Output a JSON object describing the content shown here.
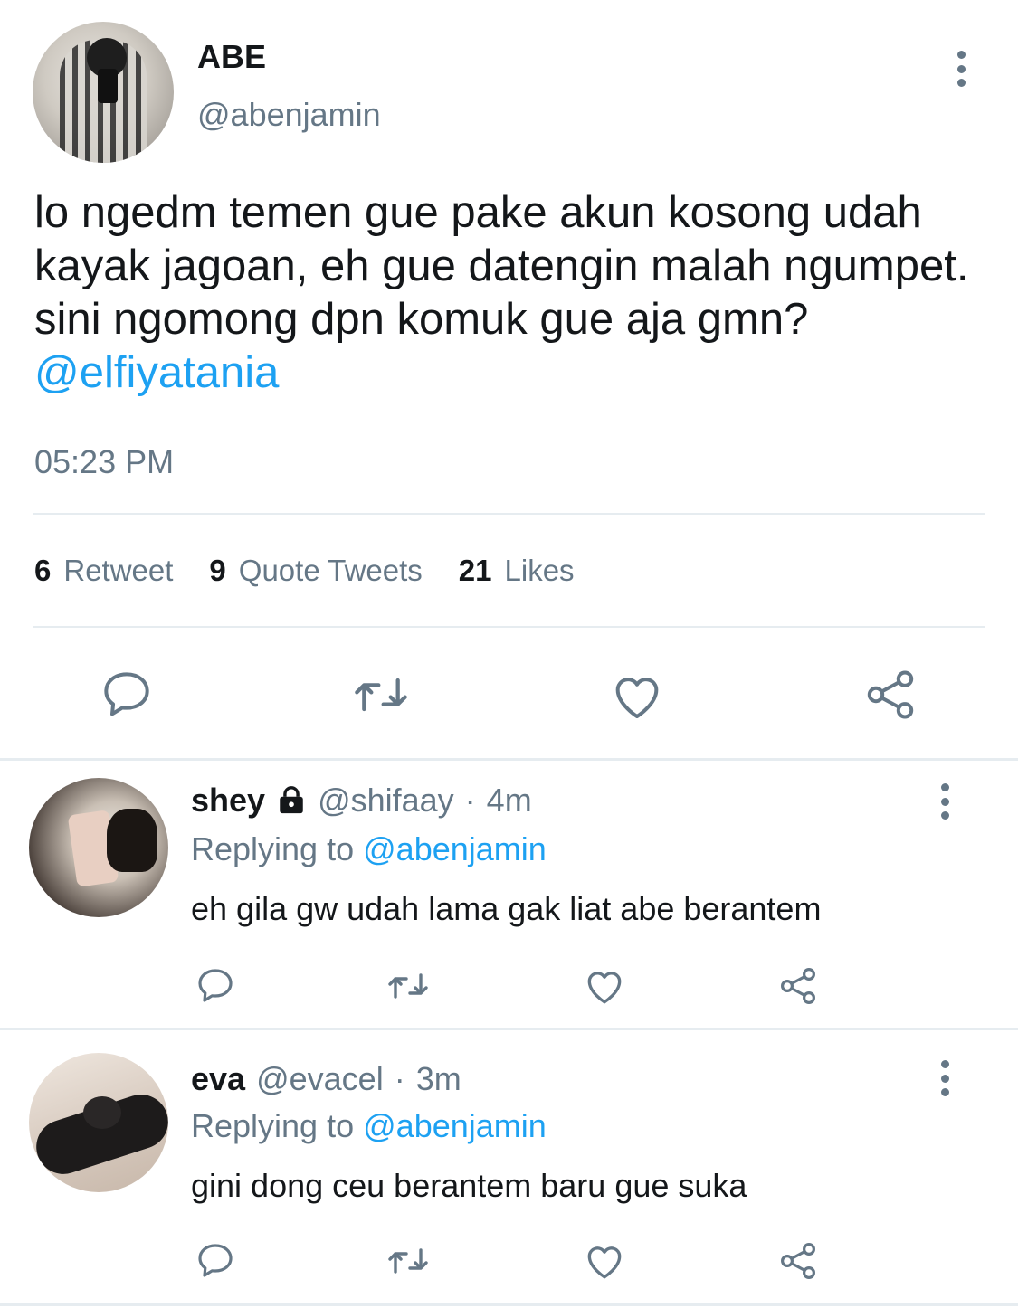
{
  "tweet": {
    "author_name": "ABE",
    "author_handle": "@abenjamin",
    "text_parts": [
      "lo ngedm temen gue pake akun kosong udah kayak jagoan, eh gue datengin malah ngumpet. sini ngomong dpn komuk gue aja gmn? ",
      "@elfiyatania"
    ],
    "time": "05:23 PM",
    "stats": {
      "retweets_count": "6",
      "retweets_label": "Retweet",
      "quotes_count": "9",
      "quotes_label": "Quote Tweets",
      "likes_count": "21",
      "likes_label": "Likes"
    },
    "actions": [
      "reply-icon",
      "retweet-icon",
      "like-icon",
      "share-icon"
    ],
    "avatar": "profile-photo"
  },
  "replies": [
    {
      "name": "shey",
      "locked": true,
      "handle": "@shifaay",
      "separator": "·",
      "time": "4m",
      "replying_prefix": "Replying to",
      "replying_handle": "@abenjamin",
      "text": "eh gila gw udah lama gak liat abe berantem"
    },
    {
      "name": "eva",
      "locked": false,
      "handle": "@evacel",
      "separator": "·",
      "time": "3m",
      "replying_prefix": "Replying to",
      "replying_handle": "@abenjamin",
      "text": "gini dong ceu berantem baru gue suka"
    }
  ],
  "colors": {
    "accent": "#1da1f2",
    "secondary_text": "#657786",
    "primary_text": "#14171a",
    "divider": "#e6ecf0"
  }
}
